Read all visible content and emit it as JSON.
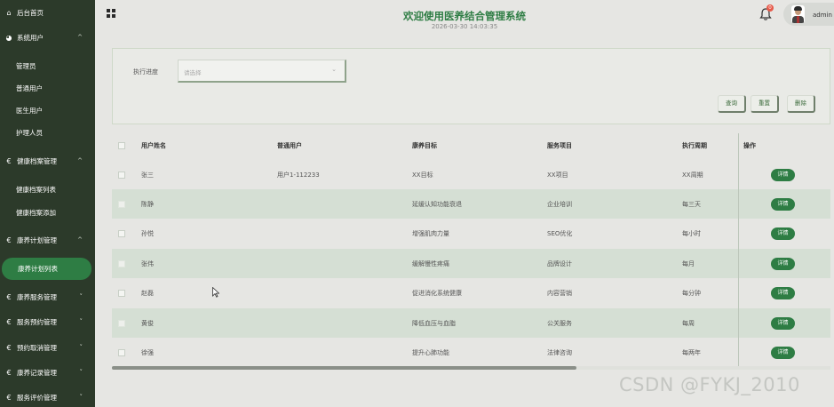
{
  "sidebar": {
    "items": [
      {
        "label": "后台首页",
        "icon": "home-icon",
        "glyph": "⌂",
        "arrow": ""
      },
      {
        "label": "系统用户",
        "icon": "user-system-icon",
        "glyph": "◕",
        "arrow": "^"
      },
      {
        "label": "管理员",
        "sub": true
      },
      {
        "label": "普通用户",
        "sub": true
      },
      {
        "label": "医生用户",
        "sub": true
      },
      {
        "label": "护理人员",
        "sub": true
      },
      {
        "label": "健康档案管理",
        "icon": "euro-icon",
        "glyph": "€",
        "arrow": "^"
      },
      {
        "label": "健康档案列表",
        "sub": true
      },
      {
        "label": "健康档案添加",
        "sub": true
      },
      {
        "label": "康养计划管理",
        "icon": "euro-icon",
        "glyph": "€",
        "arrow": "^"
      },
      {
        "label": "康养计划列表",
        "sub": true,
        "active": true
      },
      {
        "label": "康养服务管理",
        "icon": "euro-icon",
        "glyph": "€",
        "arrow": "˅"
      },
      {
        "label": "服务预约管理",
        "icon": "euro-icon",
        "glyph": "€",
        "arrow": "˅"
      },
      {
        "label": "预约取消管理",
        "icon": "euro-icon",
        "glyph": "€",
        "arrow": "˅"
      },
      {
        "label": "康养记录管理",
        "icon": "euro-icon",
        "glyph": "€",
        "arrow": "˅"
      },
      {
        "label": "服务评价管理",
        "icon": "euro-icon",
        "glyph": "€",
        "arrow": "˅"
      }
    ]
  },
  "header": {
    "title": "欢迎使用医养结合管理系统",
    "datetime": "2026-03-30 14:03:35",
    "notification_count": "0",
    "username": "admin"
  },
  "search": {
    "progress_label": "执行进度",
    "progress_placeholder": "请选择",
    "query_label": "查询",
    "reset_label": "重置",
    "delete_label": "删除"
  },
  "table": {
    "headers": [
      "用户姓名",
      "普通用户",
      "康养目标",
      "服务项目",
      "执行周期",
      "操作"
    ],
    "detail_label": "详情",
    "rows": [
      {
        "name": "张三",
        "user": "用户1-112233",
        "goal": "XX目标",
        "service": "XX项目",
        "cycle": "XX周期"
      },
      {
        "name": "陈静",
        "user": "",
        "goal": "延缓认知功能衰退",
        "service": "企业培训",
        "cycle": "每三天"
      },
      {
        "name": "孙悦",
        "user": "",
        "goal": "增强肌肉力量",
        "service": "SEO优化",
        "cycle": "每小时"
      },
      {
        "name": "张伟",
        "user": "",
        "goal": "缓解慢性疼痛",
        "service": "品牌设计",
        "cycle": "每月"
      },
      {
        "name": "赵磊",
        "user": "",
        "goal": "促进消化系统健康",
        "service": "内容营销",
        "cycle": "每分钟"
      },
      {
        "name": "黄俊",
        "user": "",
        "goal": "降低血压与血脂",
        "service": "公关服务",
        "cycle": "每周"
      },
      {
        "name": "徐强",
        "user": "",
        "goal": "提升心肺功能",
        "service": "法律咨询",
        "cycle": "每两年"
      }
    ]
  },
  "watermark": "CSDN @FYKJ_2010",
  "colors": {
    "accent": "#2e7d44",
    "sidebar_bg": "#2c3a2a",
    "row_alt": "#d5dfd4"
  }
}
